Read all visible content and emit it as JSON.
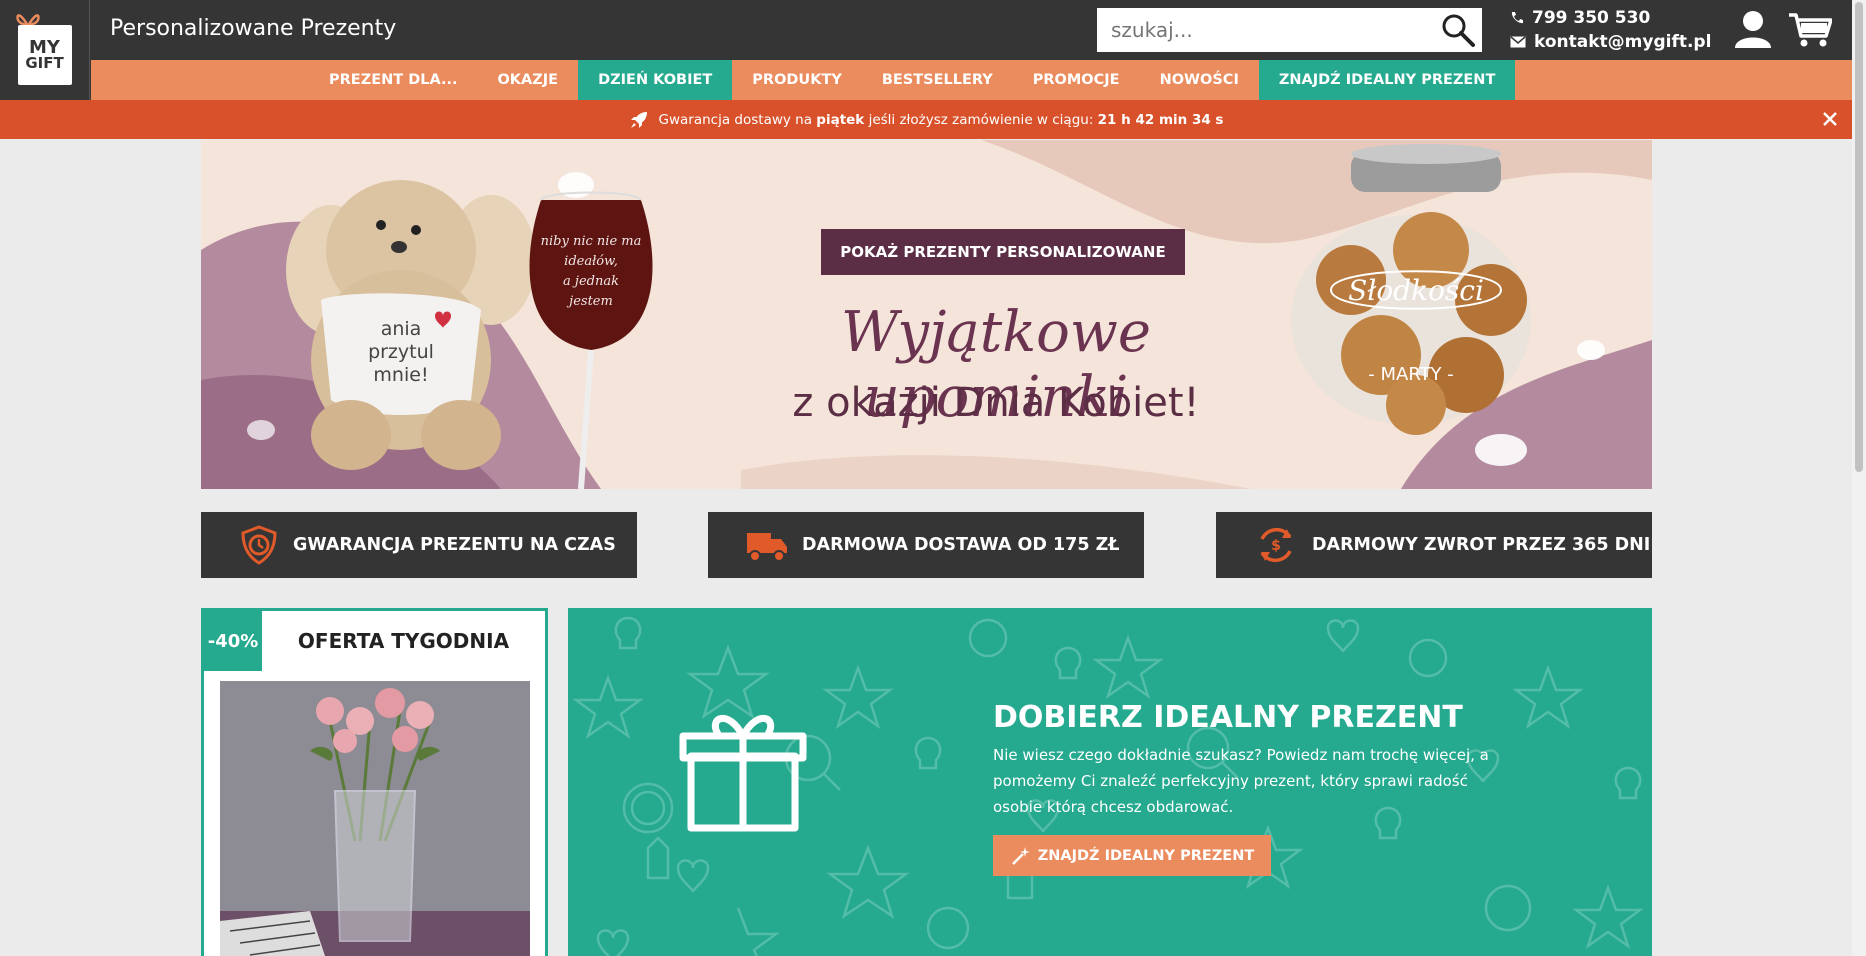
{
  "header": {
    "logo_line1": "MY",
    "logo_line2": "GIFT",
    "site_title": "Personalizowane Prezenty",
    "search_placeholder": "szukaj...",
    "phone": "799 350 530",
    "email": "kontakt@mygift.pl"
  },
  "nav": {
    "items": [
      {
        "label": "PREZENT DLA..."
      },
      {
        "label": "OKAZJE"
      },
      {
        "label": "DZIEŃ KOBIET"
      },
      {
        "label": "PRODUKTY"
      },
      {
        "label": "BESTSELLERY"
      },
      {
        "label": "PROMOCJE"
      },
      {
        "label": "NOWOŚCI"
      },
      {
        "label": "ZNAJDŹ IDEALNY PREZENT"
      }
    ]
  },
  "promo": {
    "text_before": "Gwarancja dostawy na ",
    "day": "piątek",
    "text_middle": " jeśli złożysz zamówienie w ciągu: ",
    "countdown": "21 h 42 min 34 s"
  },
  "hero": {
    "button_label": "POKAŻ PREZENTY PERSONALIZOWANE",
    "headline_script": "Wyjątkowe upominki",
    "headline_sub": "z okazji Dnia Kobiet!",
    "bear_shirt_text": "ania przytul mnie!",
    "glass_text": "niby nic nie ma ideałów, a jednak jestem",
    "jar_text": "Słodkości",
    "jar_name": "- MARTY -"
  },
  "features": [
    {
      "label": "GWARANCJA PREZENTU NA CZAS"
    },
    {
      "label": "DARMOWA DOSTAWA OD 175 ZŁ"
    },
    {
      "label": "DARMOWY ZWROT PRZEZ 365 DNI"
    }
  ],
  "offer": {
    "badge": "-40%",
    "title": "OFERTA TYGODNIA"
  },
  "finder": {
    "title": "DOBIERZ IDEALNY PREZENT",
    "text": "Nie wiesz czego dokładnie szukasz? Powiedz nam trochę więcej, a pomożemy Ci znaleźć perfekcyjny prezent, który sprawi radość osobie którą chcesz obdarować.",
    "button_label": "ZNAJDŹ IDEALNY PREZENT"
  },
  "colors": {
    "dark": "#353535",
    "orange": "#ea8c5e",
    "teal": "#25a98f",
    "red": "#d9512a",
    "plum": "#5b2e45"
  }
}
